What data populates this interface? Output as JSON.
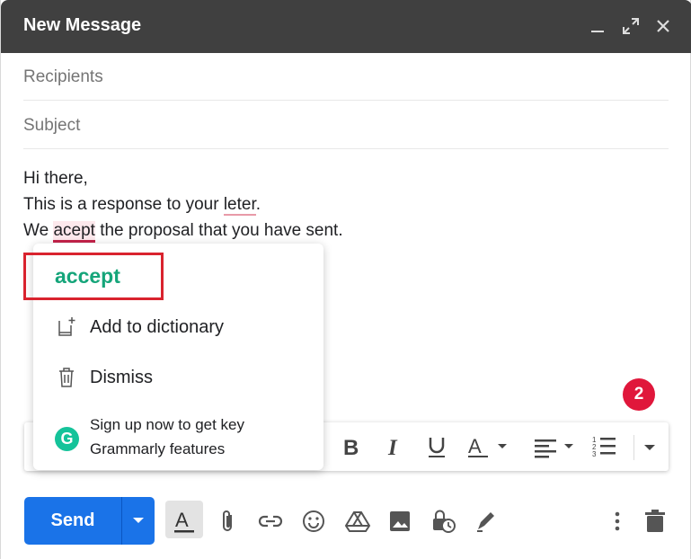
{
  "window": {
    "title": "New Message"
  },
  "fields": {
    "recipients_placeholder": "Recipients",
    "subject_placeholder": "Subject"
  },
  "body": {
    "line1": "Hi there,",
    "line2_before": "This is a response to your ",
    "line2_error": "leter",
    "line2_after": ".",
    "line3_before": "We ",
    "line3_error": "acept",
    "line3_after": " the proposal that you have sent."
  },
  "grammarly_popup": {
    "suggestion": "accept",
    "add_to_dictionary": "Add to dictionary",
    "dismiss": "Dismiss",
    "signup_line1": "Sign up now to get key",
    "signup_line2": "Grammarly features",
    "logo_letter": "G"
  },
  "badge": {
    "count": "2"
  },
  "toolbar": {
    "send_label": "Send"
  },
  "colors": {
    "titlebar": "#404040",
    "send": "#1a73e8",
    "grammarly_green": "#15a57a",
    "error_red": "#c5234b",
    "highlight_box": "#d9232e"
  }
}
